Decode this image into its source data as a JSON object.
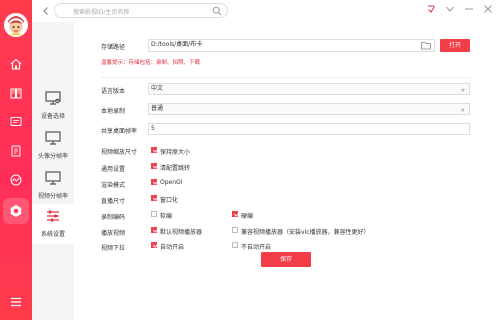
{
  "search": {
    "placeholder": "搜索影视ID/主页名称"
  },
  "side_tabs": [
    {
      "label": "设备选择"
    },
    {
      "label": "头像分帧率"
    },
    {
      "label": "视频分帧率"
    },
    {
      "label": "系统设置"
    }
  ],
  "settings": {
    "storage_label": "存储路径",
    "storage_value": "D:/tools/桌面/布卡",
    "open_button": "打开",
    "warning": "温馨提示：存储包括：录制、拍照、下载",
    "language_label": "语言版本",
    "language_value": "中文",
    "local_record_label": "本地录制",
    "local_record_value": "普通",
    "share_port_label": "共享桌面帧率",
    "share_port_value": "5",
    "video_size_label": "视频缩放尺寸",
    "video_size_option": "保持原大小",
    "common_label": "通用设置",
    "common_option": "清配置跳转",
    "render_label": "渲染模式",
    "render_option": "OpenGl",
    "live_size_label": "直播尺寸",
    "live_size_option": "窗口化",
    "record_encode_label": "录制编码",
    "record_encode_soft": "软编",
    "record_encode_hard": "硬编",
    "play_video_label": "播放视频",
    "play_video_default": "默认视频播放器",
    "play_video_compat": "兼容视频播放器（安装vlc播放器，兼容性更好）",
    "video_download_label": "视频下拉",
    "video_download_on": "自动开启",
    "video_download_off": "不自动开启",
    "save_button": "保存"
  },
  "colors": {
    "accent": "#f23c48",
    "rail": "#ff3052"
  }
}
